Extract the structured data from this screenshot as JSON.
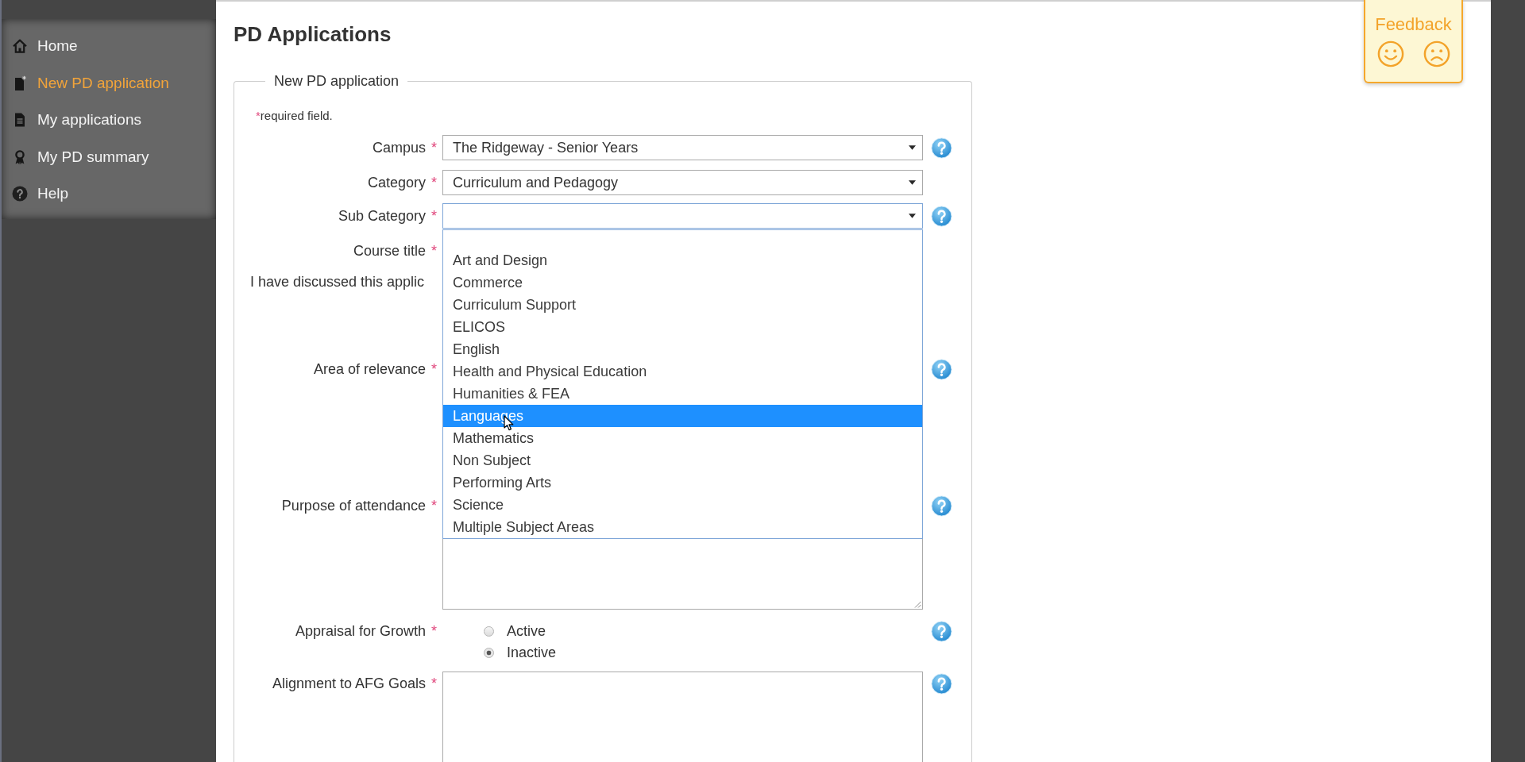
{
  "sidebar": {
    "items": [
      {
        "label": "Home",
        "selected": false
      },
      {
        "label": "New PD application",
        "selected": true
      },
      {
        "label": "My applications",
        "selected": false
      },
      {
        "label": "My PD summary",
        "selected": false
      },
      {
        "label": "Help",
        "selected": false
      }
    ]
  },
  "page": {
    "title": "PD Applications"
  },
  "feedback": {
    "label": "Feedback"
  },
  "form": {
    "legend": "New PD application",
    "required_note": {
      "mark": "*",
      "text": "required field."
    },
    "fields": [
      {
        "kind": "select",
        "label": "Campus",
        "mark": "*",
        "value": "The Ridgeway - Senior Years",
        "focused": false,
        "open": false,
        "help": true
      },
      {
        "kind": "select",
        "label": "Category",
        "mark": "*",
        "value": "Curriculum and Pedagogy",
        "focused": false,
        "open": false,
        "help": false
      },
      {
        "kind": "select",
        "label": "Sub Category",
        "mark": "*",
        "focused": true,
        "open": true,
        "help": true,
        "options": [
          {
            "label": "Art and Design",
            "selected": false
          },
          {
            "label": "Commerce",
            "selected": false
          },
          {
            "label": "Curriculum Support",
            "selected": false
          },
          {
            "label": "ELICOS",
            "selected": false
          },
          {
            "label": "English",
            "selected": false
          },
          {
            "label": "Health and Physical Education",
            "selected": false
          },
          {
            "label": "Humanities & FEA",
            "selected": false
          },
          {
            "label": "Languages",
            "selected": true
          },
          {
            "label": "Mathematics",
            "selected": false
          },
          {
            "label": "Non Subject",
            "selected": false
          },
          {
            "label": "Performing Arts",
            "selected": false
          },
          {
            "label": "Science",
            "selected": false
          },
          {
            "label": "Multiple Subject Areas",
            "selected": false
          }
        ]
      },
      {
        "kind": "covered",
        "label": "Course title",
        "mark": "*",
        "help": false
      },
      {
        "kind": "note",
        "label": "I have discussed this applic"
      },
      {
        "kind": "covered",
        "label": "Area of relevance",
        "mark": "*",
        "help": true
      },
      {
        "kind": "textarea",
        "label": "Purpose of attendance",
        "mark": "*",
        "help": true,
        "resize_handle": true
      },
      {
        "kind": "radio",
        "label": "Appraisal for Growth",
        "mark": "*",
        "help": true,
        "options": [
          {
            "label": "Active",
            "selected": false
          },
          {
            "label": "Inactive",
            "selected": true
          }
        ]
      },
      {
        "kind": "textarea",
        "label": "Alignment to AFG Goals",
        "mark": "*",
        "help": true,
        "resize_handle": false
      }
    ]
  }
}
